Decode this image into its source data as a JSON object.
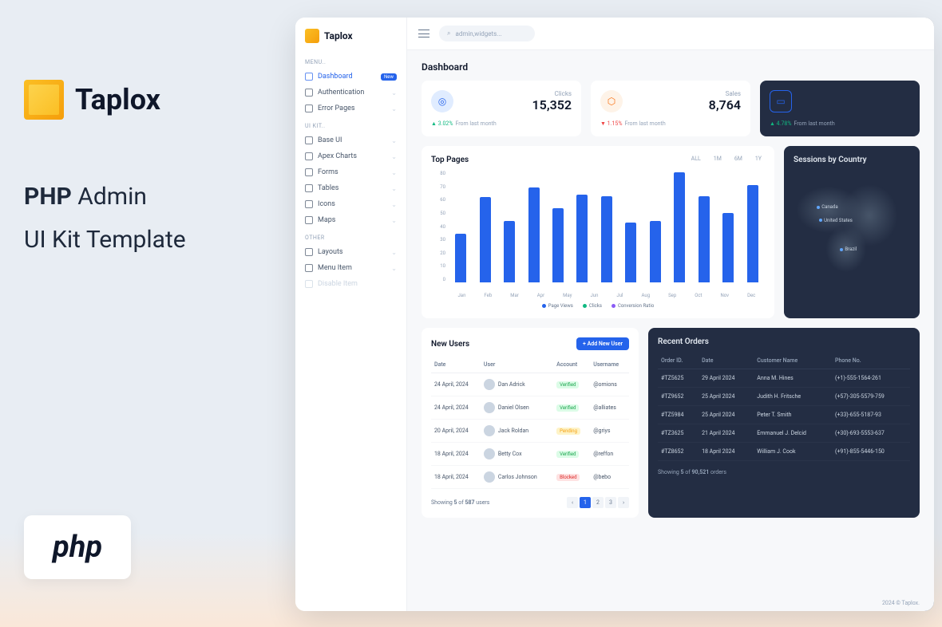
{
  "promo": {
    "brand": "Taplox",
    "heading1_bold": "PHP",
    "heading1_rest": " Admin",
    "heading2": "UI Kit Template",
    "php_label": "php"
  },
  "app": {
    "brand": "Taplox",
    "search_placeholder": "admin,widgets..."
  },
  "sidebar": {
    "section_menu": "MENU..",
    "section_ui": "UI KIT..",
    "section_other": "OTHER",
    "new_badge": "New",
    "items_menu": [
      {
        "label": "Dashboard",
        "active": true,
        "badge": true
      },
      {
        "label": "Authentication",
        "chevron": true
      },
      {
        "label": "Error Pages",
        "chevron": true
      }
    ],
    "items_ui": [
      {
        "label": "Base UI",
        "chevron": true
      },
      {
        "label": "Apex Charts",
        "chevron": true
      },
      {
        "label": "Forms",
        "chevron": true
      },
      {
        "label": "Tables",
        "chevron": true
      },
      {
        "label": "Icons",
        "chevron": true
      },
      {
        "label": "Maps",
        "chevron": true
      }
    ],
    "items_other": [
      {
        "label": "Layouts",
        "chevron": true
      },
      {
        "label": "Menu Item",
        "chevron": true
      },
      {
        "label": "Disable Item",
        "disabled": true
      }
    ]
  },
  "page_title": "Dashboard",
  "stats": [
    {
      "label": "Clicks",
      "value": "15,352",
      "trend": "3.02%",
      "trend_dir": "up",
      "trend_sub": "From last month",
      "icon": "blue"
    },
    {
      "label": "Sales",
      "value": "8,764",
      "trend": "1.15%",
      "trend_dir": "down",
      "trend_sub": "From last month",
      "icon": "orange"
    },
    {
      "label": "",
      "value": "",
      "trend": "4.78%",
      "trend_dir": "up",
      "trend_sub": "From last month",
      "icon": "dark"
    }
  ],
  "chart_data": {
    "type": "bar",
    "title": "Top Pages",
    "categories": [
      "Jan",
      "Feb",
      "Mar",
      "Apr",
      "May",
      "Jun",
      "Jul",
      "Aug",
      "Sep",
      "Oct",
      "Nov",
      "Dec"
    ],
    "series": [
      {
        "name": "Page Views",
        "values": [
          35,
          61,
          44,
          68,
          53,
          63,
          62,
          43,
          44,
          79,
          62,
          50,
          70
        ]
      }
    ],
    "y_ticks": [
      "80",
      "70",
      "60",
      "50",
      "40",
      "30",
      "20",
      "10",
      "0"
    ],
    "legend": [
      {
        "label": "Page Views",
        "color": "#2563eb"
      },
      {
        "label": "Clicks",
        "color": "#10b981"
      },
      {
        "label": "Conversion Ratio",
        "color": "#8b5cf6"
      }
    ],
    "time_filters": [
      "ALL",
      "1M",
      "6M",
      "1Y"
    ]
  },
  "country_panel": {
    "title": "Sessions by Country",
    "pins": [
      "Canada",
      "United States",
      "Brazil"
    ]
  },
  "new_users": {
    "title": "New Users",
    "add_label": "+ Add New User",
    "headers": [
      "Date",
      "User",
      "Account",
      "Username"
    ],
    "rows": [
      {
        "date": "24 April, 2024",
        "name": "Dan Adrick",
        "status": "Verified",
        "status_class": "verified",
        "username": "@omions"
      },
      {
        "date": "24 April, 2024",
        "name": "Daniel Olsen",
        "status": "Verified",
        "status_class": "verified",
        "username": "@alliates"
      },
      {
        "date": "20 April, 2024",
        "name": "Jack Roldan",
        "status": "Pending",
        "status_class": "pending",
        "username": "@griys"
      },
      {
        "date": "18 April, 2024",
        "name": "Betty Cox",
        "status": "Verified",
        "status_class": "verified",
        "username": "@reffon"
      },
      {
        "date": "18 April, 2024",
        "name": "Carlos Johnson",
        "status": "Blocked",
        "status_class": "blocked",
        "username": "@bebo"
      }
    ],
    "footer_pre": "Showing ",
    "footer_b1": "5",
    "footer_mid": " of ",
    "footer_b2": "587",
    "footer_post": " users",
    "pages": [
      "‹",
      "1",
      "2",
      "3",
      "›"
    ]
  },
  "orders": {
    "title": "Recent Orders",
    "headers": [
      "Order ID.",
      "Date",
      "Customer Name",
      "Phone No."
    ],
    "rows": [
      {
        "id": "#TZ5625",
        "date": "29 April 2024",
        "name": "Anna M. Hines",
        "phone": "(+1)-555-1564-261"
      },
      {
        "id": "#TZ9652",
        "date": "25 April 2024",
        "name": "Judith H. Fritsche",
        "phone": "(+57)-305-5579-759"
      },
      {
        "id": "#TZ5984",
        "date": "25 April 2024",
        "name": "Peter T. Smith",
        "phone": "(+33)-655-5187-93"
      },
      {
        "id": "#TZ3625",
        "date": "21 April 2024",
        "name": "Emmanuel J. Delcid",
        "phone": "(+30)-693-5553-637"
      },
      {
        "id": "#TZ8652",
        "date": "18 April 2024",
        "name": "William J. Cook",
        "phone": "(+91)-855-5446-150"
      }
    ],
    "footer_pre": "Showing ",
    "footer_b1": "5",
    "footer_mid": " of ",
    "footer_b2": "90,521",
    "footer_post": " orders"
  },
  "footer": "2024 © Taplox."
}
